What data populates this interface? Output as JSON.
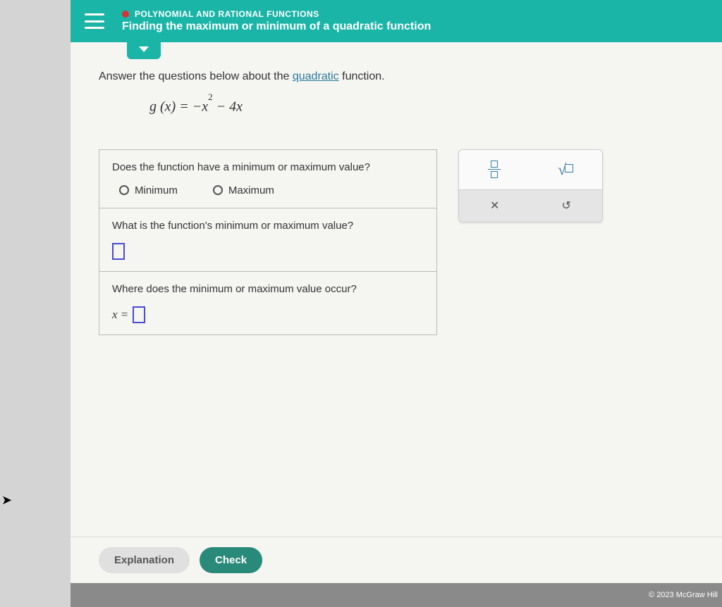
{
  "header": {
    "breadcrumb": "POLYNOMIAL AND RATIONAL FUNCTIONS",
    "title": "Finding the maximum or minimum of a quadratic function"
  },
  "content": {
    "instruction_pre": "Answer the questions below about the ",
    "instruction_link": "quadratic",
    "instruction_post": " function.",
    "equation_lhs": "g (x) = ",
    "equation_rhs_a": "−x",
    "equation_exp": "2",
    "equation_rhs_b": " − 4x"
  },
  "questions": {
    "q1": "Does the function have a minimum or maximum value?",
    "q1_opt1": "Minimum",
    "q1_opt2": "Maximum",
    "q2": "What is the function's minimum or maximum value?",
    "q3": "Where does the minimum or maximum value occur?",
    "q3_prefix": "x ="
  },
  "tools": {
    "close": "✕",
    "reset": "↺"
  },
  "footer": {
    "explanation": "Explanation",
    "check": "Check",
    "copyright": "© 2023 McGraw Hill"
  }
}
